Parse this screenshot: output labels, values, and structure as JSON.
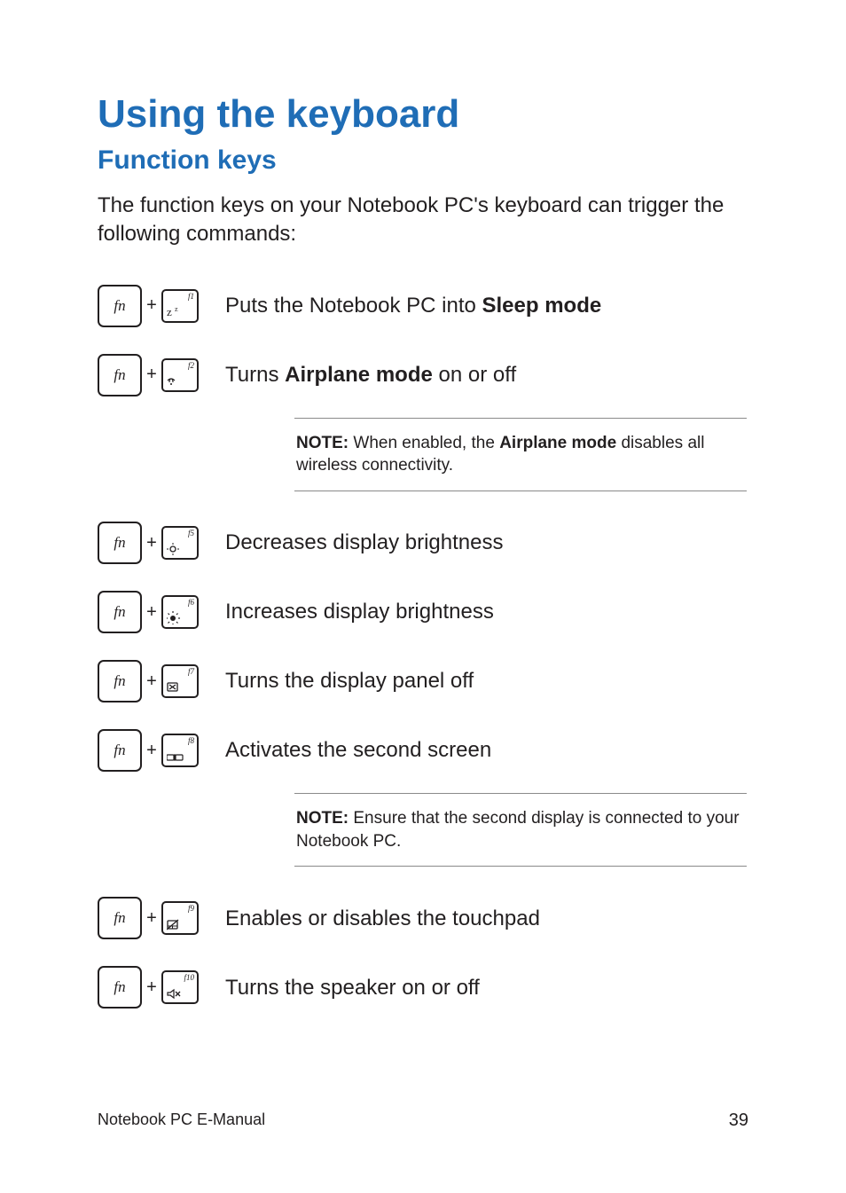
{
  "title": "Using the keyboard",
  "subtitle": "Function keys",
  "intro": "The function keys on your Notebook PC's keyboard can trigger the following commands:",
  "fn_label": "fn",
  "plus": "+",
  "rows": {
    "f1": {
      "num": "f1",
      "desc_pre": "Puts the Notebook PC into ",
      "desc_bold": "Sleep mode",
      "desc_post": ""
    },
    "f2": {
      "num": "f2",
      "desc_pre": "Turns ",
      "desc_bold": "Airplane mode",
      "desc_post": " on or off"
    },
    "f5": {
      "num": "f5",
      "desc": "Decreases display brightness"
    },
    "f6": {
      "num": "f6",
      "desc": "Increases display brightness"
    },
    "f7": {
      "num": "f7",
      "desc": "Turns the display panel off"
    },
    "f8": {
      "num": "f8",
      "desc": "Activates the second screen"
    },
    "f9": {
      "num": "f9",
      "desc": "Enables or disables the touchpad"
    },
    "f10": {
      "num": "f10",
      "desc": "Turns the speaker on or off"
    }
  },
  "notes": {
    "airplane": {
      "label": "NOTE:",
      "pre": " When enabled, the ",
      "bold": "Airplane mode",
      "post": " disables all wireless connectivity."
    },
    "display": {
      "label": "NOTE:",
      "text": " Ensure that the second display is connected to your Notebook PC."
    }
  },
  "footer": {
    "left": "Notebook PC E-Manual",
    "right": "39"
  }
}
